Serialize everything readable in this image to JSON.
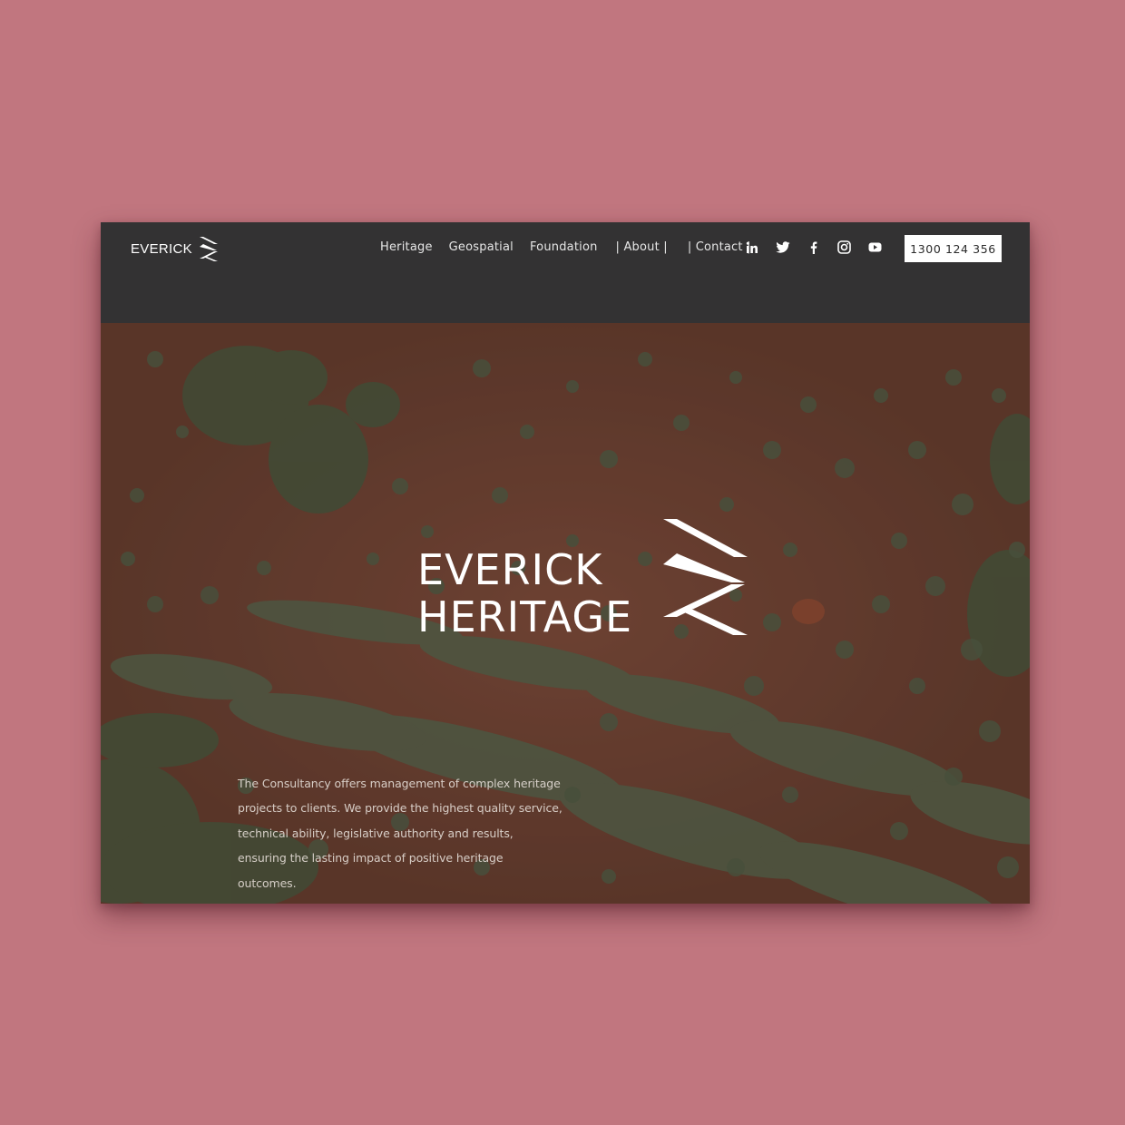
{
  "brand": {
    "name": "EVERICK",
    "mark_icon": "chevron-stripes-logo-icon"
  },
  "nav": {
    "items": [
      {
        "label": "Heritage"
      },
      {
        "label": "Geospatial"
      },
      {
        "label": "Foundation"
      },
      {
        "label": "| About |"
      },
      {
        "label": "| Contact |"
      }
    ]
  },
  "socials": [
    {
      "icon": "linkedin-icon"
    },
    {
      "icon": "twitter-icon"
    },
    {
      "icon": "facebook-icon"
    },
    {
      "icon": "instagram-icon"
    },
    {
      "icon": "youtube-icon"
    }
  ],
  "phone": {
    "label": "1300 124 356"
  },
  "hero": {
    "title_line1": "EVERICK",
    "title_line2": "HERITAGE",
    "description": "The Consultancy offers management of complex heritage projects to clients. We provide the highest quality service, technical ability, legislative authority and results, ensuring the lasting impact of positive heritage outcomes."
  },
  "colors": {
    "page_background": "#c1767f",
    "nav_background": "#333233",
    "hero_earth": "#7a4a38",
    "vegetation": "#4d5a40",
    "button_background": "#ffffff"
  }
}
